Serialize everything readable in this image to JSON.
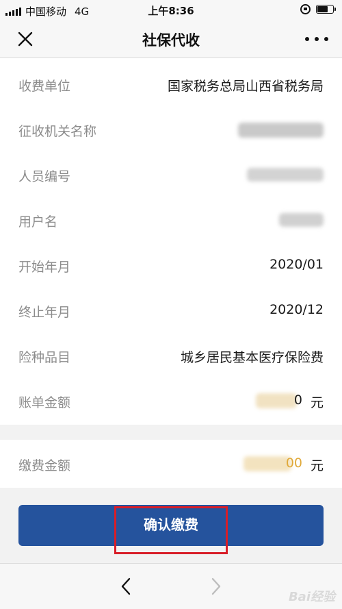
{
  "status_bar": {
    "carrier": "中国移动",
    "network": "4G",
    "time": "上午8:36"
  },
  "nav": {
    "title": "社保代收"
  },
  "details": [
    {
      "label": "收费单位",
      "value": "国家税务总局山西省税务局"
    },
    {
      "label": "征收机关名称",
      "value": ""
    },
    {
      "label": "人员编号",
      "value": ""
    },
    {
      "label": "用户名",
      "value": ""
    },
    {
      "label": "开始年月",
      "value": "2020/01"
    },
    {
      "label": "终止年月",
      "value": "2020/12"
    },
    {
      "label": "险种品目",
      "value": "城乡居民基本医疗保险费"
    },
    {
      "label": "账单金额",
      "value_tail": "0",
      "unit": "元"
    }
  ],
  "payment": {
    "label": "缴费金额",
    "value_tail": "00",
    "unit": "元"
  },
  "confirm_button": "确认缴费",
  "watermark": "Bai经验",
  "colors": {
    "button": "#25539d",
    "highlight_border": "#d81e28"
  }
}
